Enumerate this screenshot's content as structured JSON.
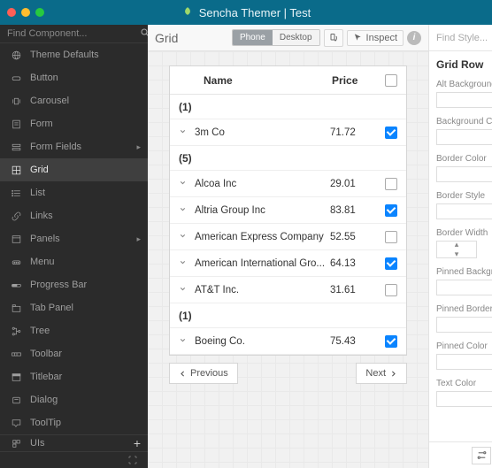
{
  "titlebar": {
    "text": "Sencha Themer | Test"
  },
  "sidebar": {
    "search_placeholder": "Find Component...",
    "items": [
      {
        "label": "Theme Defaults",
        "icon": "globe"
      },
      {
        "label": "Button",
        "icon": "button"
      },
      {
        "label": "Carousel",
        "icon": "carousel"
      },
      {
        "label": "Form",
        "icon": "form"
      },
      {
        "label": "Form Fields",
        "icon": "form-fields",
        "submenu": true
      },
      {
        "label": "Grid",
        "icon": "grid",
        "active": true
      },
      {
        "label": "List",
        "icon": "list"
      },
      {
        "label": "Links",
        "icon": "link"
      },
      {
        "label": "Panels",
        "icon": "panel",
        "submenu": true
      },
      {
        "label": "Menu",
        "icon": "menu"
      },
      {
        "label": "Progress Bar",
        "icon": "progress"
      },
      {
        "label": "Tab Panel",
        "icon": "tabs"
      },
      {
        "label": "Tree",
        "icon": "tree"
      },
      {
        "label": "Toolbar",
        "icon": "toolbar"
      },
      {
        "label": "Titlebar",
        "icon": "titlebar"
      },
      {
        "label": "Dialog",
        "icon": "dialog"
      },
      {
        "label": "ToolTip",
        "icon": "tooltip"
      }
    ],
    "bottom": {
      "label": "UIs"
    }
  },
  "toolbar": {
    "title": "Grid",
    "phone": "Phone",
    "desktop": "Desktop",
    "inspect": "Inspect"
  },
  "grid": {
    "columns": {
      "name": "Name",
      "price": "Price"
    },
    "sections": [
      {
        "group": "(1)",
        "rows": [
          {
            "name": "3m Co",
            "price": "71.72",
            "checked": true
          }
        ]
      },
      {
        "group": "(5)",
        "rows": [
          {
            "name": "Alcoa Inc",
            "price": "29.01",
            "checked": false
          },
          {
            "name": "Altria Group Inc",
            "price": "83.81",
            "checked": true
          },
          {
            "name": "American Express Company",
            "price": "52.55",
            "checked": false
          },
          {
            "name": "American International Gro...",
            "price": "64.13",
            "checked": true
          },
          {
            "name": "AT&T Inc.",
            "price": "31.61",
            "checked": false
          }
        ]
      },
      {
        "group": "(1)",
        "rows": [
          {
            "name": "Boeing Co.",
            "price": "75.43",
            "checked": true
          }
        ]
      }
    ],
    "pager": {
      "prev": "Previous",
      "next": "Next"
    }
  },
  "rightpanel": {
    "search_placeholder": "Find Style...",
    "title": "Grid Row",
    "props": [
      {
        "label": "Alt Background Color",
        "type": "color"
      },
      {
        "label": "Background Color",
        "type": "color"
      },
      {
        "label": "Border Color",
        "type": "color"
      },
      {
        "label": "Border Style",
        "type": "select"
      },
      {
        "label": "Border Width",
        "type": "number"
      },
      {
        "label": "Pinned Background Color",
        "type": "color"
      },
      {
        "label": "Pinned Border Color",
        "type": "color"
      },
      {
        "label": "Pinned Color",
        "type": "color"
      },
      {
        "label": "Text Color",
        "type": "color"
      }
    ]
  }
}
